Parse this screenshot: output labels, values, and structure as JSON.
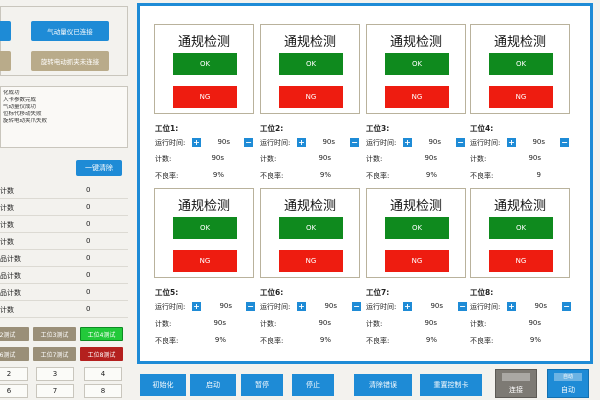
{
  "connections": {
    "gas_meter": "气动量仪已连接",
    "rotary_gripper": "旋转电动抓夹未连接"
  },
  "log_lines": [
    "化成功",
    "入卡参数完成",
    "气动量仪成功",
    "位标代移动失败",
    "旋转电动夹爪失败"
  ],
  "stats": {
    "clear_label": "一键清除",
    "rows": [
      {
        "label": "计数",
        "value": "0"
      },
      {
        "label": "计数",
        "value": "0"
      },
      {
        "label": "计数",
        "value": "0"
      },
      {
        "label": "计数",
        "value": "0"
      },
      {
        "label": "品计数",
        "value": "0"
      },
      {
        "label": "品计数",
        "value": "0"
      },
      {
        "label": "品计数",
        "value": "0"
      },
      {
        "label": "计数",
        "value": "0"
      }
    ]
  },
  "test_buttons": [
    {
      "label": "2测试"
    },
    {
      "label": "工位3测试"
    },
    {
      "label": "工位4测试"
    },
    {
      "label": "6测试"
    },
    {
      "label": "工位7测试"
    },
    {
      "label": "工位8测试"
    }
  ],
  "num_cells": [
    "2",
    "3",
    "4",
    "6",
    "7",
    "8"
  ],
  "stations": [
    {
      "title": "通规检测",
      "ok": "OK",
      "ng": "NG",
      "name": "工位1:",
      "run_label": "运行时间:",
      "run_value": "90s",
      "count_label": "计数:",
      "count_value": "90s",
      "defect_label": "不良率:",
      "defect_value": "9%"
    },
    {
      "title": "通规检测",
      "ok": "OK",
      "ng": "NG",
      "name": "工位2:",
      "run_label": "运行时间:",
      "run_value": "90s",
      "count_label": "计数:",
      "count_value": "90s",
      "defect_label": "不良率:",
      "defect_value": "9%"
    },
    {
      "title": "通规检测",
      "ok": "OK",
      "ng": "NG",
      "name": "工位3:",
      "run_label": "运行时间:",
      "run_value": "90s",
      "count_label": "计数:",
      "count_value": "90s",
      "defect_label": "不良率:",
      "defect_value": "9%"
    },
    {
      "title": "通规检测",
      "ok": "OK",
      "ng": "NG",
      "name": "工位4:",
      "run_label": "运行时间:",
      "run_value": "90s",
      "count_label": "计数:",
      "count_value": "90s",
      "defect_label": "不良率:",
      "defect_value": "9"
    },
    {
      "title": "通规检测",
      "ok": "OK",
      "ng": "NG",
      "name": "工位5:",
      "run_label": "运行时间:",
      "run_value": "90s",
      "count_label": "计数:",
      "count_value": "90s",
      "defect_label": "不良率:",
      "defect_value": "9%"
    },
    {
      "title": "通规检测",
      "ok": "OK",
      "ng": "NG",
      "name": "工位6:",
      "run_label": "运行时间:",
      "run_value": "90s",
      "count_label": "计数:",
      "count_value": "90s",
      "defect_label": "不良率:",
      "defect_value": "9%"
    },
    {
      "title": "通规检测",
      "ok": "OK",
      "ng": "NG",
      "name": "工位7:",
      "run_label": "运行时间:",
      "run_value": "90s",
      "count_label": "计数:",
      "count_value": "90s",
      "defect_label": "不良率:",
      "defect_value": "9%"
    },
    {
      "title": "通规检测",
      "ok": "OK",
      "ng": "NG",
      "name": "工位8:",
      "run_label": "运行时间:",
      "run_value": "90s",
      "count_label": "计数:",
      "count_value": "90s",
      "defect_label": "不良率:",
      "defect_value": "9%"
    }
  ],
  "controls": {
    "init": "初始化",
    "start": "启动",
    "pause": "暂停",
    "stop": "停止",
    "clear_error": "清除错误",
    "reset_card": "重置控制卡"
  },
  "modes": {
    "connect": "连接",
    "auto": "自动",
    "badge": "自动"
  },
  "colors": {
    "accent": "#1e8bd6",
    "ok": "#0f8a1e",
    "ng": "#ee1c10",
    "test_active": "#22c93a",
    "test_alarm": "#b4201e",
    "test_idle": "#9a8f78"
  }
}
